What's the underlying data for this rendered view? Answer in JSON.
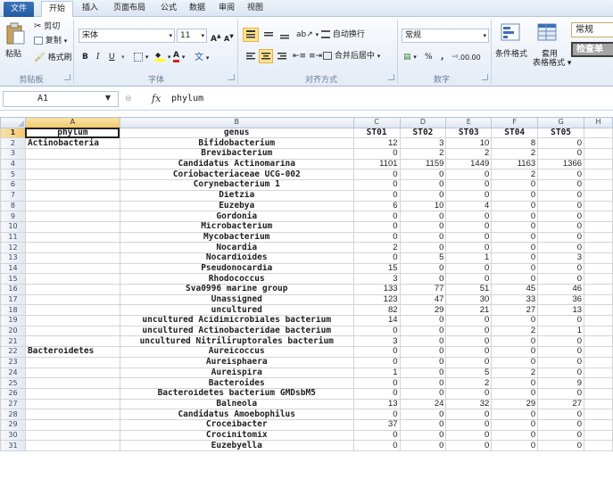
{
  "tabs": [
    "文件",
    "开始",
    "插入",
    "页面布局",
    "公式",
    "数据",
    "审阅",
    "视图"
  ],
  "ribbon": {
    "clipboard": {
      "paste": "粘贴",
      "cut": "剪切",
      "copy": "复制",
      "format_painter": "格式刷",
      "label": "剪贴板"
    },
    "font": {
      "name": "宋体",
      "size": "11",
      "bold": "B",
      "italic": "I",
      "underline": "U",
      "label": "字体"
    },
    "alignment": {
      "wrap": "自动换行",
      "merge": "合并后居中",
      "label": "对齐方式"
    },
    "number": {
      "format": "常规",
      "percent": "%",
      "comma": ",",
      "label": "数字"
    },
    "styles": {
      "conditional": "条件格式",
      "table": "套用\n表格格式",
      "style_normal": "常规",
      "style_check": "检查单"
    }
  },
  "formula_bar": {
    "name_box": "A1",
    "fx": "fx",
    "formula": "phylum"
  },
  "colors": {
    "accent": "#215aa3",
    "selected_header": "#f2c86b",
    "check_cell": "#a5a5a5"
  },
  "columns": [
    "A",
    "B",
    "C",
    "D",
    "E",
    "F",
    "G",
    "H"
  ],
  "rows": [
    {
      "n": "1",
      "phylum": "phylum",
      "genus": "genus",
      "v": [
        "ST01",
        "ST02",
        "ST03",
        "ST04",
        "ST05"
      ]
    },
    {
      "n": "2",
      "phylum": "Actinobacteria",
      "genus": "Bifidobacterium",
      "v": [
        "12",
        "3",
        "10",
        "8",
        "0"
      ]
    },
    {
      "n": "3",
      "phylum": "",
      "genus": "Brevibacterium",
      "v": [
        "0",
        "2",
        "2",
        "2",
        "0"
      ]
    },
    {
      "n": "4",
      "phylum": "",
      "genus": "Candidatus Actinomarina",
      "v": [
        "1101",
        "1159",
        "1449",
        "1163",
        "1366"
      ]
    },
    {
      "n": "5",
      "phylum": "",
      "genus": "Coriobacteriaceae UCG-002",
      "v": [
        "0",
        "0",
        "0",
        "2",
        "0"
      ]
    },
    {
      "n": "6",
      "phylum": "",
      "genus": "Corynebacterium 1",
      "v": [
        "0",
        "0",
        "0",
        "0",
        "0"
      ]
    },
    {
      "n": "7",
      "phylum": "",
      "genus": "Dietzia",
      "v": [
        "0",
        "0",
        "0",
        "0",
        "0"
      ]
    },
    {
      "n": "8",
      "phylum": "",
      "genus": "Euzebya",
      "v": [
        "6",
        "10",
        "4",
        "0",
        "0"
      ]
    },
    {
      "n": "9",
      "phylum": "",
      "genus": "Gordonia",
      "v": [
        "0",
        "0",
        "0",
        "0",
        "0"
      ]
    },
    {
      "n": "10",
      "phylum": "",
      "genus": "Microbacterium",
      "v": [
        "0",
        "0",
        "0",
        "0",
        "0"
      ]
    },
    {
      "n": "11",
      "phylum": "",
      "genus": "Mycobacterium",
      "v": [
        "0",
        "0",
        "0",
        "0",
        "0"
      ]
    },
    {
      "n": "12",
      "phylum": "",
      "genus": "Nocardia",
      "v": [
        "2",
        "0",
        "0",
        "0",
        "0"
      ]
    },
    {
      "n": "13",
      "phylum": "",
      "genus": "Nocardioides",
      "v": [
        "0",
        "5",
        "1",
        "0",
        "3"
      ]
    },
    {
      "n": "14",
      "phylum": "",
      "genus": "Pseudonocardia",
      "v": [
        "15",
        "0",
        "0",
        "0",
        "0"
      ]
    },
    {
      "n": "15",
      "phylum": "",
      "genus": "Rhodococcus",
      "v": [
        "3",
        "0",
        "0",
        "0",
        "0"
      ]
    },
    {
      "n": "16",
      "phylum": "",
      "genus": "Sva0996 marine group",
      "v": [
        "133",
        "77",
        "51",
        "45",
        "46"
      ]
    },
    {
      "n": "17",
      "phylum": "",
      "genus": "Unassigned",
      "v": [
        "123",
        "47",
        "30",
        "33",
        "36"
      ]
    },
    {
      "n": "18",
      "phylum": "",
      "genus": "uncultured",
      "v": [
        "82",
        "29",
        "21",
        "27",
        "13"
      ]
    },
    {
      "n": "19",
      "phylum": "",
      "genus": "uncultured Acidimicrobiales bacterium",
      "v": [
        "14",
        "0",
        "0",
        "0",
        "0"
      ]
    },
    {
      "n": "20",
      "phylum": "",
      "genus": "uncultured Actinobacteridae bacterium",
      "v": [
        "0",
        "0",
        "0",
        "2",
        "1"
      ]
    },
    {
      "n": "21",
      "phylum": "",
      "genus": "uncultured Nitriliruptorales bacterium",
      "v": [
        "3",
        "0",
        "0",
        "0",
        "0"
      ]
    },
    {
      "n": "22",
      "phylum": "Bacteroidetes",
      "genus": "Aureicoccus",
      "v": [
        "0",
        "0",
        "0",
        "0",
        "0"
      ]
    },
    {
      "n": "23",
      "phylum": "",
      "genus": "Aureisphaera",
      "v": [
        "0",
        "0",
        "0",
        "0",
        "0"
      ]
    },
    {
      "n": "24",
      "phylum": "",
      "genus": "Aureispira",
      "v": [
        "1",
        "0",
        "5",
        "2",
        "0"
      ]
    },
    {
      "n": "25",
      "phylum": "",
      "genus": "Bacteroides",
      "v": [
        "0",
        "0",
        "2",
        "0",
        "9"
      ]
    },
    {
      "n": "26",
      "phylum": "",
      "genus": "Bacteroidetes bacterium GMDsbM5",
      "v": [
        "0",
        "0",
        "0",
        "0",
        "0"
      ]
    },
    {
      "n": "27",
      "phylum": "",
      "genus": "Balneola",
      "v": [
        "13",
        "24",
        "32",
        "29",
        "27"
      ]
    },
    {
      "n": "28",
      "phylum": "",
      "genus": "Candidatus Amoebophilus",
      "v": [
        "0",
        "0",
        "0",
        "0",
        "0"
      ]
    },
    {
      "n": "29",
      "phylum": "",
      "genus": "Croceibacter",
      "v": [
        "37",
        "0",
        "0",
        "0",
        "0"
      ]
    },
    {
      "n": "30",
      "phylum": "",
      "genus": "Crocinitomix",
      "v": [
        "0",
        "0",
        "0",
        "0",
        "0"
      ]
    },
    {
      "n": "31",
      "phylum": "",
      "genus": "Euzebyella",
      "v": [
        "0",
        "0",
        "0",
        "0",
        "0"
      ]
    }
  ]
}
